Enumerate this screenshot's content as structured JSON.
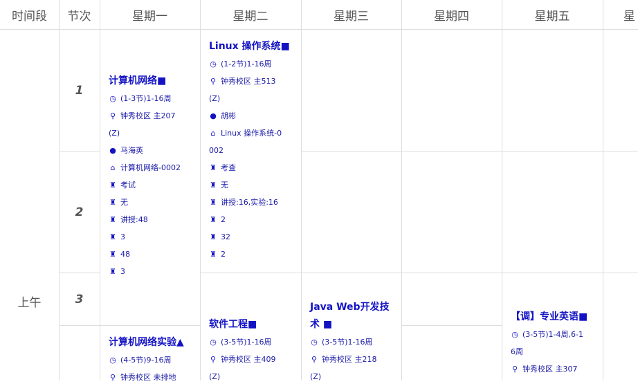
{
  "header": {
    "period": "时间段",
    "section": "节次",
    "days": [
      "星期一",
      "星期二",
      "星期三",
      "星期四",
      "星期五",
      "星"
    ]
  },
  "period_label": "上午",
  "sections": [
    "1",
    "2",
    "3"
  ],
  "icons": {
    "time": "clock-icon",
    "location": "map-pin-icon",
    "teacher": "user-icon",
    "class": "home-icon",
    "detail": "rook-icon"
  },
  "colors": {
    "course_text": "#1313c4",
    "grid": "#dddddd",
    "header_text": "#555555"
  },
  "courses": {
    "mon_net": {
      "title": "计算机网络",
      "marker": "■",
      "time": "(1-3节)1-16周",
      "location": "钟秀校区 主207",
      "location_cont": "(Z)",
      "teacher": "马海英",
      "class": "计算机网络-0002",
      "exam": "考试",
      "note": "无",
      "hours": "讲授:48",
      "credit": "3",
      "total": "48",
      "weekly": "3"
    },
    "tue_linux": {
      "title": "Linux 操作系统",
      "marker": "■",
      "time": "(1-2节)1-16周",
      "location": "钟秀校区 主513",
      "location_cont": "(Z)",
      "teacher": "胡彬",
      "class": "Linux 操作系统-0",
      "class_cont": "002",
      "exam": "考查",
      "note": "无",
      "hours": "讲授:16,实验:16",
      "credit": "2",
      "total": "32",
      "weekly": "2"
    },
    "tue_se": {
      "title": "软件工程",
      "marker": "■",
      "time": "(3-5节)1-16周",
      "location": "钟秀校区 主409",
      "location_cont": "(Z)"
    },
    "wed_java": {
      "title": "Java Web开发技术",
      "marker": "■",
      "time": "(3-5节)1-16周",
      "location": "钟秀校区 主218",
      "location_cont": "(Z)"
    },
    "fri_eng": {
      "title": "【调】专业英语",
      "marker": "■",
      "time": "(3-5节)1-4周,6-1",
      "time_cont": "6周",
      "location": "钟秀校区 主307"
    },
    "mon_netlab": {
      "title": "计算机网络实验",
      "marker": "▲",
      "time": "(4-5节)9-16周",
      "location": "钟秀校区 未排地"
    }
  }
}
